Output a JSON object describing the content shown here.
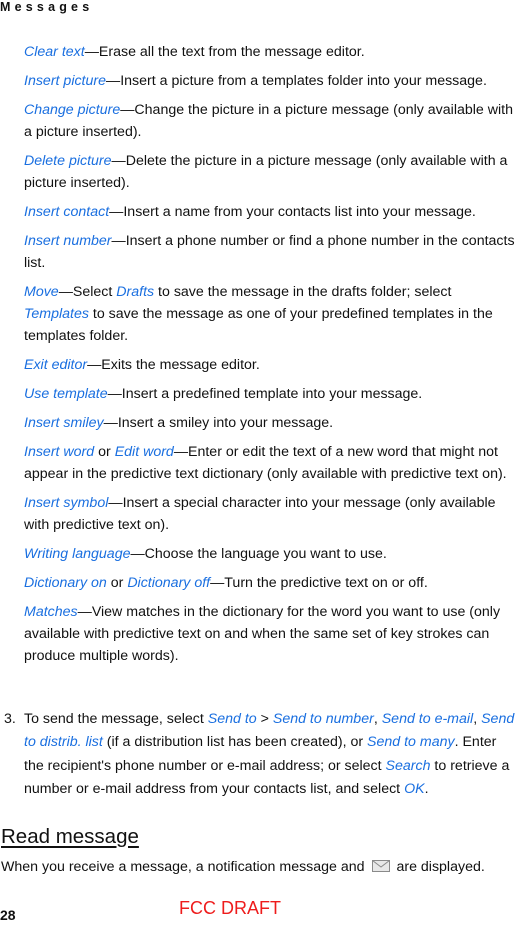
{
  "header": {
    "section": "Messages"
  },
  "options": [
    {
      "name": "Clear text",
      "desc": "—Erase all the text from the message editor."
    },
    {
      "name": "Insert picture",
      "desc": "—Insert a picture from a templates folder into your message."
    },
    {
      "name": "Change picture",
      "desc": "—Change the picture in a picture message (only available with a picture inserted)."
    },
    {
      "name": "Delete picture",
      "desc": "—Delete the picture in a picture message (only available with a picture inserted)."
    },
    {
      "name": "Insert contact",
      "desc": "—Insert a name from your contacts list into your message."
    },
    {
      "name": "Insert number",
      "desc": "—Insert a phone number or find a phone number in the contacts list."
    },
    {
      "name": "Move",
      "desc_1": "—Select ",
      "link_1": "Drafts",
      "desc_2": " to save the message in the drafts folder; select ",
      "link_2": "Templates",
      "desc_3": " to save the message as one of your predefined templates in the templates folder."
    },
    {
      "name": "Exit editor",
      "desc": "—Exits the message editor."
    },
    {
      "name": "Use template",
      "desc": "—Insert a predefined template into your message."
    },
    {
      "name": "Insert smiley",
      "desc": "—Insert a smiley into your message."
    },
    {
      "name": "Insert word",
      "or": " or ",
      "name_2": "Edit word",
      "desc": "—Enter or edit the text of a new word that might not appear in the predictive text dictionary (only available with predictive text on)."
    },
    {
      "name": "Insert symbol",
      "desc": "—Insert a special character into your message (only available with predictive text on)."
    },
    {
      "name": "Writing language",
      "desc": "—Choose the language you want to use."
    },
    {
      "name": "Dictionary on",
      "or": " or ",
      "name_2": "Dictionary off",
      "desc": "—Turn the predictive text on or off."
    },
    {
      "name": "Matches",
      "desc": "—View matches in the dictionary for the word you want to use (only available with predictive text on and when the same set of key strokes can produce multiple words)."
    }
  ],
  "step3": {
    "number": "3.",
    "t1": "To send the message, select ",
    "l1": "Send to",
    "t2": " > ",
    "l2": "Send to number",
    "t3": ", ",
    "l3": "Send to e-mail",
    "t4": ", ",
    "l4": "Send to distrib. list",
    "t5": " (if a distribution list has been created), or ",
    "l5": "Send to many",
    "t6": ". Enter the recipient's phone number or e-mail address; or select ",
    "l6": "Search",
    "t7": " to retrieve a number or e-mail address from your contacts list, and select ",
    "l7": "OK",
    "t8": "."
  },
  "read_message": {
    "title": "Read message",
    "text_before": "When you receive a message, a notification message and ",
    "icon": "envelope-icon",
    "text_after": " are displayed."
  },
  "footer": {
    "page_number": "28",
    "draft_label": "FCC DRAFT",
    "draft_color": "#ee1c1c"
  },
  "colors": {
    "link": "#1a6fe0",
    "text": "#111111"
  }
}
